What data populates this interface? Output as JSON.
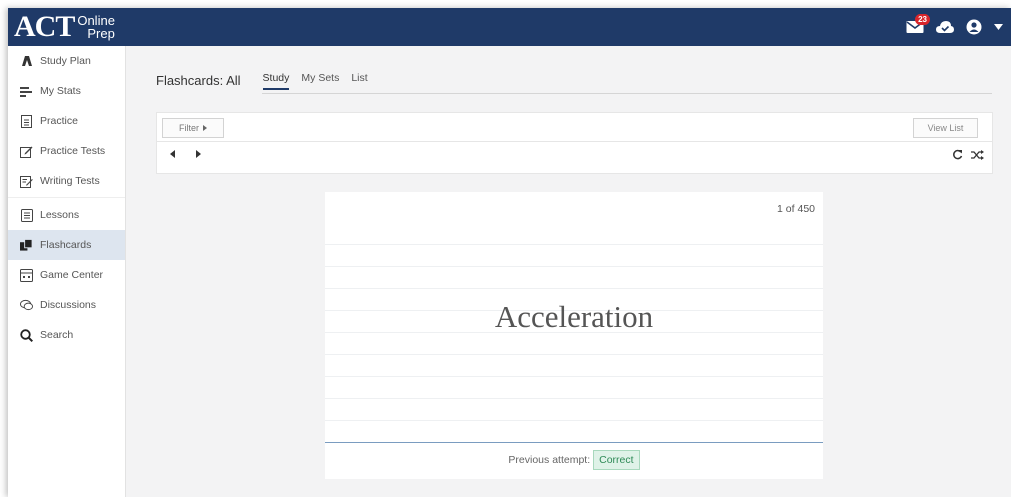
{
  "brand": {
    "logo_text": "ACT",
    "logo_sub1": "Online",
    "logo_sub2": "Prep"
  },
  "header": {
    "notification_count": "23",
    "icons": [
      "mail-icon",
      "cloud-icon",
      "user-circle-icon",
      "caret-down-icon"
    ]
  },
  "sidebar": {
    "items": [
      {
        "label": "Study Plan",
        "icon": "study-plan-icon"
      },
      {
        "label": "My Stats",
        "icon": "stats-icon"
      },
      {
        "label": "Practice",
        "icon": "document-icon"
      },
      {
        "label": "Practice Tests",
        "icon": "edit-icon"
      },
      {
        "label": "Writing Tests",
        "icon": "writing-icon"
      },
      {
        "label": "Lessons",
        "icon": "lessons-icon"
      },
      {
        "label": "Flashcards",
        "icon": "flashcards-icon"
      },
      {
        "label": "Game Center",
        "icon": "game-icon"
      },
      {
        "label": "Discussions",
        "icon": "chat-icon"
      },
      {
        "label": "Search",
        "icon": "search-icon"
      }
    ],
    "active_label": "Flashcards"
  },
  "main": {
    "title": "Flashcards: All",
    "tabs": [
      {
        "label": "Study",
        "active": true
      },
      {
        "label": "My Sets",
        "active": false
      },
      {
        "label": "List",
        "active": false
      }
    ],
    "filter_label": "Filter",
    "view_list_label": "View List"
  },
  "card": {
    "counter": "1 of 450",
    "term": "Acceleration",
    "previous_attempt_label": "Previous attempt:",
    "previous_attempt_result": "Correct"
  },
  "colors": {
    "header_bg": "#1f3a68",
    "active_nav_bg": "#dde5ef",
    "correct_bg": "#dff2e8",
    "correct_text": "#2f8a57",
    "badge": "#d9262c"
  }
}
